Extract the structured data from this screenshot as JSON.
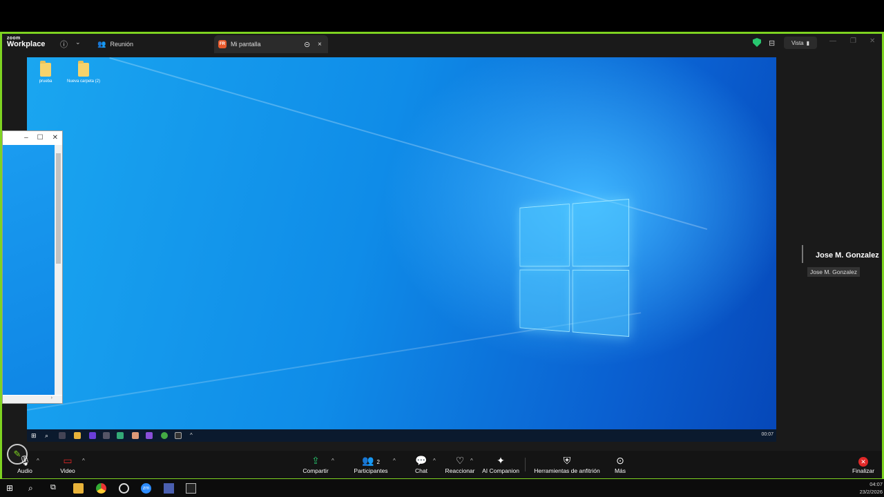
{
  "app": {
    "logo_small": "zoom",
    "logo_big": "Workplace"
  },
  "titlebar": {
    "tab_meeting": "Reunión",
    "tab_screen_badge": "FR",
    "tab_screen": "Mi pantalla",
    "view_label": "Vista"
  },
  "desktop": {
    "icons": [
      {
        "label": "prueba"
      },
      {
        "label": "Nueva carpeta (2)"
      }
    ],
    "taskbar_clock": "00:07"
  },
  "participant": {
    "name": "Jose M. Gonzalez",
    "name_tag": "Jose M. Gonzalez"
  },
  "toolbar": {
    "audio": "Audio",
    "video": "Video",
    "share": "Compartir",
    "participants": "Participantes",
    "participants_count": "2",
    "chat": "Chat",
    "react": "Reaccionar",
    "ai": "AI Companion",
    "host_tools": "Herramientas de anfitrión",
    "more": "Más",
    "end": "Finalizar"
  },
  "host_taskbar": {
    "time": "04:07",
    "date": "23/2/2026"
  },
  "colors": {
    "share_border": "#7ed321",
    "end_red": "#e02828",
    "shield_green": "#28c76f"
  }
}
